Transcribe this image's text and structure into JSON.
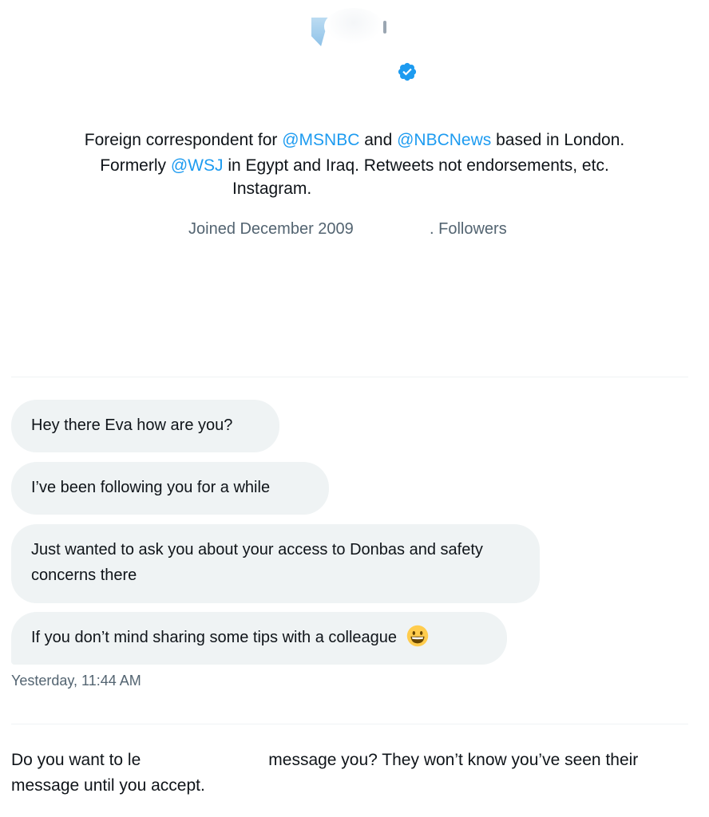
{
  "profile": {
    "bio": {
      "prefix": "Foreign correspondent for ",
      "mention_msnbc": "@MSNBC",
      "and": " and ",
      "mention_nbcnews": "@NBCNews",
      "suffix1": " based in London.",
      "line2_prefix": "Formerly ",
      "mention_wsj": "@WSJ",
      "line2_suffix": " in Egypt and Iraq. Retweets not endorsements, etc.",
      "line3": "Instagram."
    },
    "joined": "Joined December 2009",
    "followers": ". Followers",
    "verified_icon": "verified-badge-icon",
    "accent_color": "#1d9bf0"
  },
  "messages": [
    {
      "text": "Hey there Eva how are you?"
    },
    {
      "text": "I’ve been following you for a while"
    },
    {
      "text": "Just wanted to ask you about your access to Donbas and safety concerns there"
    },
    {
      "text": "If you don’t mind sharing some tips with a colleague",
      "emoji": "grinning-face-emoji"
    }
  ],
  "timestamp": "Yesterday, 11:44 AM",
  "request": {
    "part1": "Do you want to le",
    "part2": "message you? They won’t know you’ve seen their message until you accept."
  }
}
